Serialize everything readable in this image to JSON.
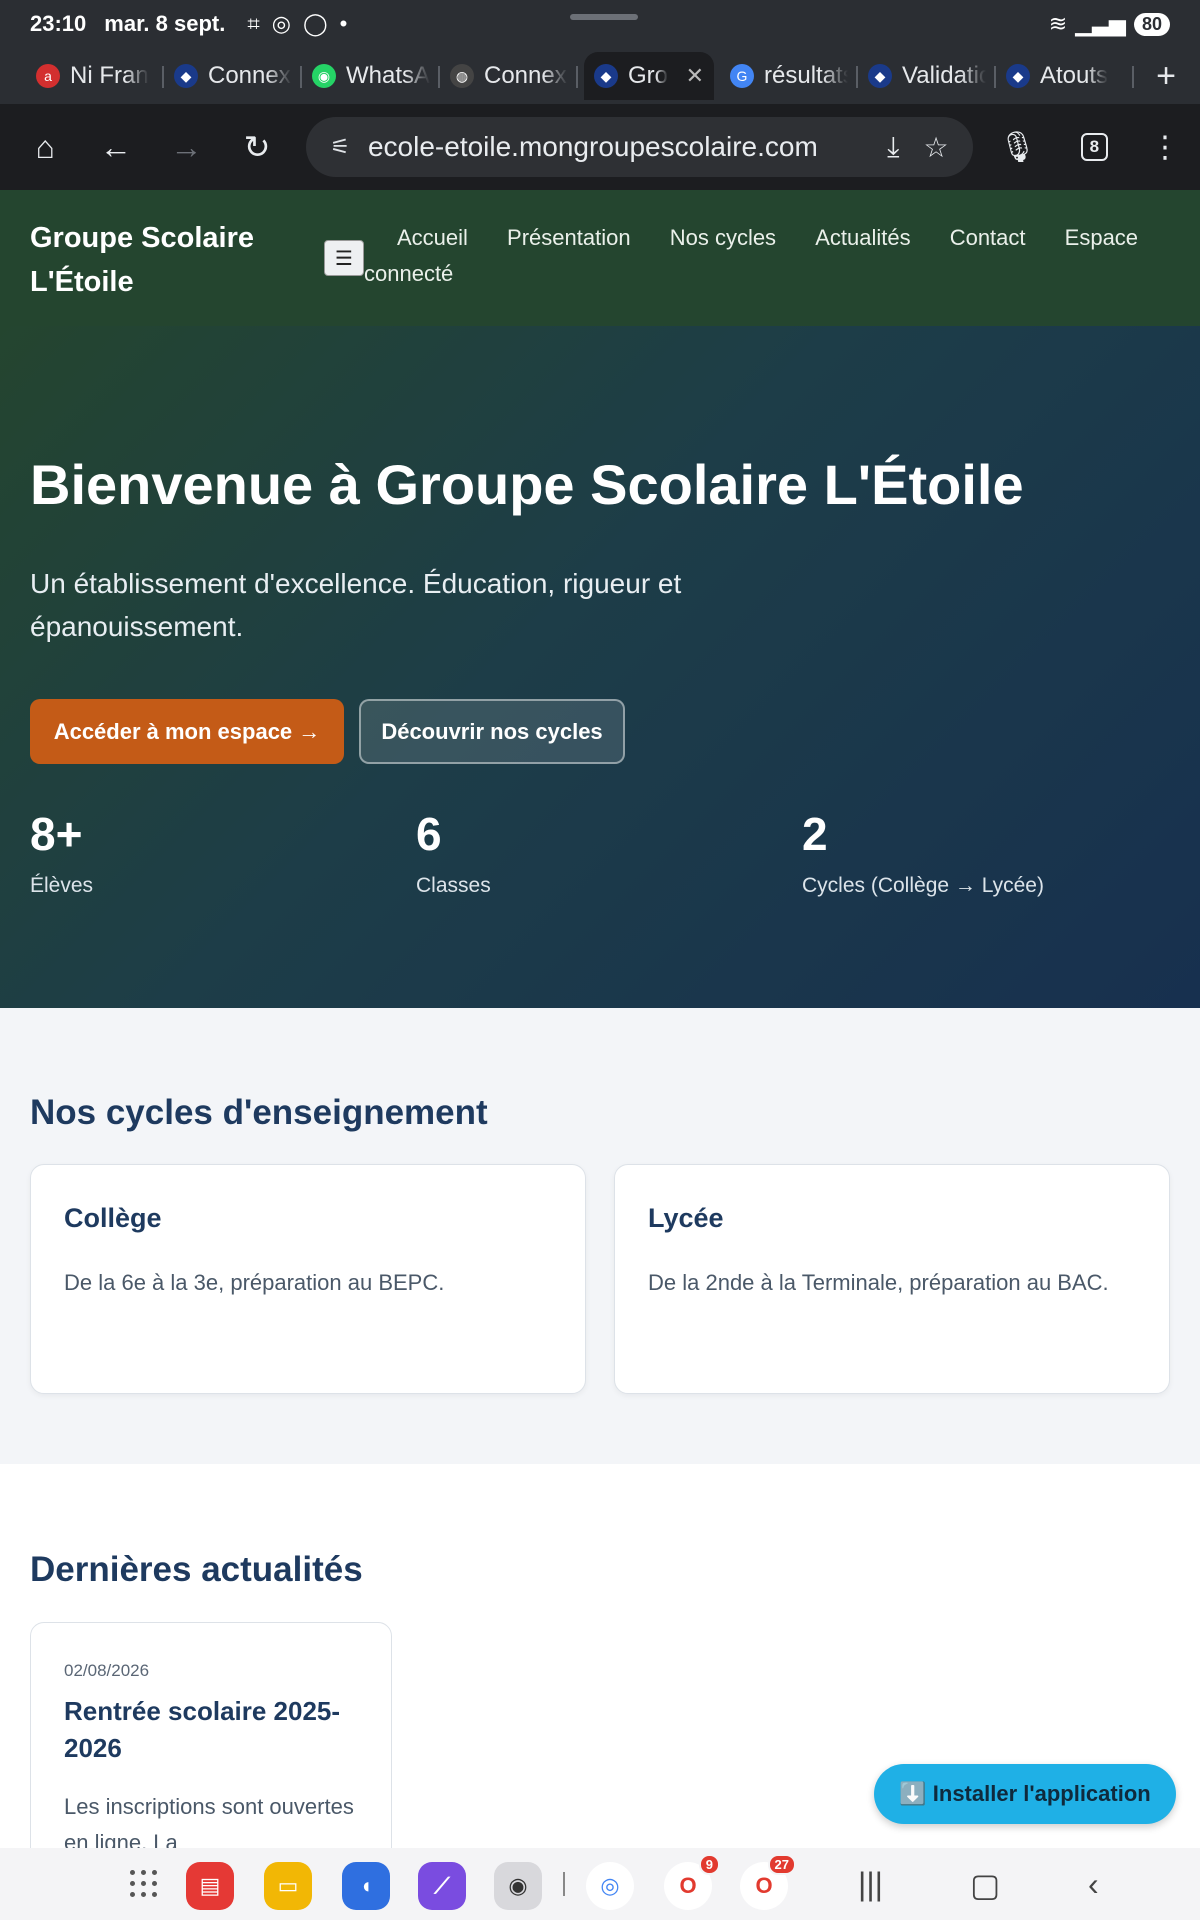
{
  "status": {
    "time": "23:10",
    "date": "mar. 8 sept.",
    "battery": "80"
  },
  "browser": {
    "tabs": [
      {
        "label": "Ni Fran",
        "icon": "a",
        "color": "#d32f2f"
      },
      {
        "label": "Connexion",
        "icon": "◆",
        "color": "#1a3a8a"
      },
      {
        "label": "WhatsApp",
        "icon": "◉",
        "color": "#25d366"
      },
      {
        "label": "Connexion",
        "icon": "◍",
        "color": "#444"
      },
      {
        "label": "Gro",
        "icon": "◆",
        "color": "#1a3a8a",
        "active": true
      },
      {
        "label": "résultats",
        "icon": "G",
        "color": "#4285f4"
      },
      {
        "label": "Validation",
        "icon": "◆",
        "color": "#1a3a8a"
      },
      {
        "label": "Atouts",
        "icon": "◆",
        "color": "#1a3a8a"
      }
    ],
    "url": "ecole-etoile.mongroupescolaire.com",
    "tab_count": "8"
  },
  "site": {
    "brand_line1": "Groupe Scolaire",
    "brand_line2": "L'Étoile",
    "menu_toggle": "☰",
    "nav": [
      "Accueil",
      "Présentation",
      "Nos cycles",
      "Actualités",
      "Contact",
      "Espace",
      "connecté"
    ]
  },
  "hero": {
    "title": "Bienvenue à Groupe Scolaire L'Étoile",
    "lead": "Un établissement d'excellence. Éducation, rigueur et épanouissement.",
    "primary_cta": "Accéder à mon espace →",
    "secondary_cta": "Découvrir nos cycles",
    "stats": [
      {
        "value": "8+",
        "label": "Élèves"
      },
      {
        "value": "6",
        "label": "Classes"
      },
      {
        "value": "2",
        "label": "Cycles (Collège → Lycée)"
      }
    ]
  },
  "cycles": {
    "title": "Nos cycles d'enseignement",
    "items": [
      {
        "name": "Collège",
        "desc": "De la 6e à la 3e, préparation au BEPC."
      },
      {
        "name": "Lycée",
        "desc": "De la 2nde à la Terminale, préparation au BAC."
      }
    ]
  },
  "news": {
    "title": "Dernières actualités",
    "items": [
      {
        "date": "02/08/2026",
        "title": "Rentrée scolaire 2025-2026",
        "excerpt": "Les inscriptions sont ouvertes en ligne. La"
      }
    ]
  },
  "install_button": "⬇️ Installer l'application",
  "dock": {
    "opera_mini_badge": "9",
    "opera_badge": "27"
  }
}
